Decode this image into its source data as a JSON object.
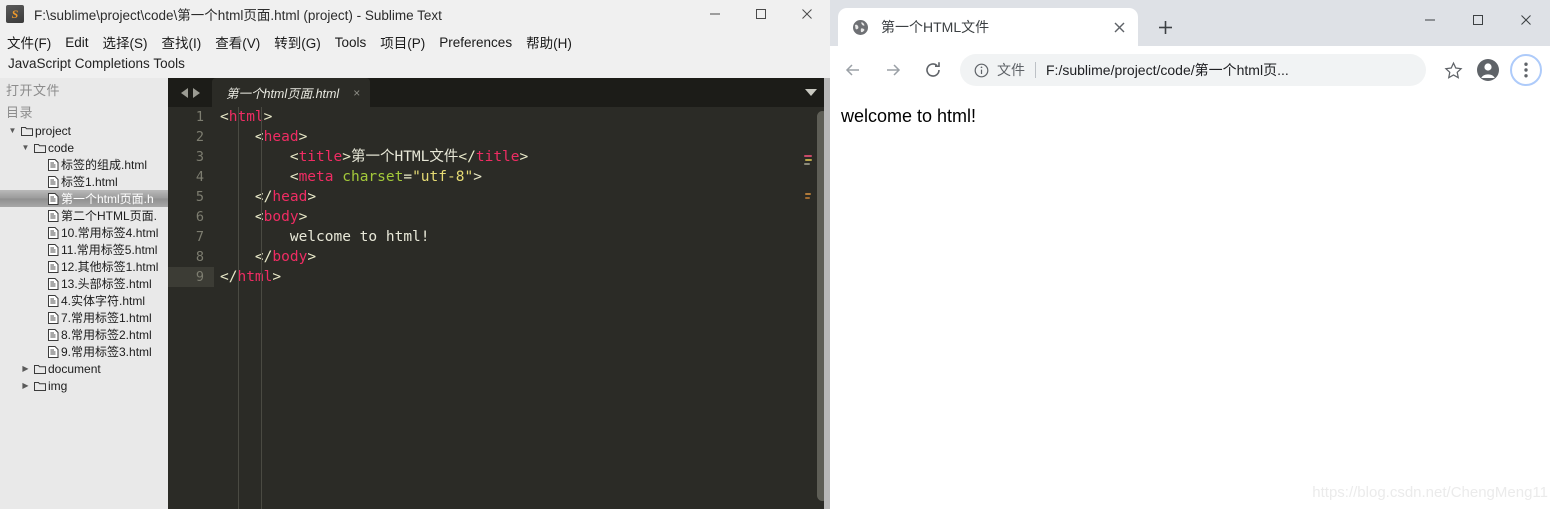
{
  "sublime": {
    "title": "F:\\sublime\\project\\code\\第一个html页面.html (project) - Sublime Text",
    "app_icon": "S",
    "window_controls": [
      {
        "name": "minimize-button",
        "glyph": "minimize"
      },
      {
        "name": "maximize-button",
        "glyph": "maximize"
      },
      {
        "name": "close-button",
        "glyph": "close"
      }
    ],
    "menu": [
      "文件(F)",
      "Edit",
      "选择(S)",
      "查找(I)",
      "查看(V)",
      "转到(G)",
      "Tools",
      "项目(P)",
      "Preferences",
      "帮助(H)"
    ],
    "status_line": "JavaScript Completions Tools",
    "sidebar": {
      "headers": [
        "打开文件",
        "目录"
      ],
      "tree": [
        {
          "label": "project",
          "type": "folder",
          "depth": 0,
          "arrow": "▼",
          "selected": false
        },
        {
          "label": "code",
          "type": "folder",
          "depth": 1,
          "arrow": "▼",
          "selected": false
        },
        {
          "label": "标签的组成.html",
          "type": "file",
          "depth": 2,
          "arrow": "",
          "selected": false
        },
        {
          "label": "标签1.html",
          "type": "file",
          "depth": 2,
          "arrow": "",
          "selected": false
        },
        {
          "label": "第一个html页面.h",
          "type": "file",
          "depth": 2,
          "arrow": "",
          "selected": true
        },
        {
          "label": "第二个HTML页面.",
          "type": "file",
          "depth": 2,
          "arrow": "",
          "selected": false
        },
        {
          "label": "10.常用标签4.html",
          "type": "file",
          "depth": 2,
          "arrow": "",
          "selected": false
        },
        {
          "label": "11.常用标签5.html",
          "type": "file",
          "depth": 2,
          "arrow": "",
          "selected": false
        },
        {
          "label": "12.其他标签1.html",
          "type": "file",
          "depth": 2,
          "arrow": "",
          "selected": false
        },
        {
          "label": "13.头部标签.html",
          "type": "file",
          "depth": 2,
          "arrow": "",
          "selected": false
        },
        {
          "label": "4.实体字符.html",
          "type": "file",
          "depth": 2,
          "arrow": "",
          "selected": false
        },
        {
          "label": "7.常用标签1.html",
          "type": "file",
          "depth": 2,
          "arrow": "",
          "selected": false
        },
        {
          "label": "8.常用标签2.html",
          "type": "file",
          "depth": 2,
          "arrow": "",
          "selected": false
        },
        {
          "label": "9.常用标签3.html",
          "type": "file",
          "depth": 2,
          "arrow": "",
          "selected": false
        },
        {
          "label": "document",
          "type": "folder",
          "depth": 1,
          "arrow": "▶",
          "selected": false
        },
        {
          "label": "img",
          "type": "folder",
          "depth": 1,
          "arrow": "▶",
          "selected": false
        }
      ]
    },
    "editor": {
      "tab_label": "第一个html页面.html",
      "tab_close": "×",
      "active_line": 9,
      "lines": [
        {
          "n": "1",
          "indent": 0,
          "segs": [
            {
              "t": "<",
              "c": "brk"
            },
            {
              "t": "html",
              "c": "tag"
            },
            {
              "t": ">",
              "c": "brk"
            }
          ]
        },
        {
          "n": "2",
          "indent": 1,
          "segs": [
            {
              "t": "<",
              "c": "brk"
            },
            {
              "t": "head",
              "c": "tag"
            },
            {
              "t": ">",
              "c": "brk"
            }
          ]
        },
        {
          "n": "3",
          "indent": 2,
          "segs": [
            {
              "t": "<",
              "c": "brk"
            },
            {
              "t": "title",
              "c": "tag"
            },
            {
              "t": ">",
              "c": "brk"
            },
            {
              "t": "第一个HTML文件",
              "c": "txt"
            },
            {
              "t": "</",
              "c": "brk"
            },
            {
              "t": "title",
              "c": "tag"
            },
            {
              "t": ">",
              "c": "brk"
            }
          ]
        },
        {
          "n": "4",
          "indent": 2,
          "segs": [
            {
              "t": "<",
              "c": "brk"
            },
            {
              "t": "meta",
              "c": "tag"
            },
            {
              "t": " ",
              "c": "txt"
            },
            {
              "t": "charset",
              "c": "attr"
            },
            {
              "t": "=",
              "c": "brk"
            },
            {
              "t": "\"utf-8\"",
              "c": "str"
            },
            {
              "t": ">",
              "c": "brk"
            }
          ]
        },
        {
          "n": "5",
          "indent": 1,
          "segs": [
            {
              "t": "</",
              "c": "brk"
            },
            {
              "t": "head",
              "c": "tag"
            },
            {
              "t": ">",
              "c": "brk"
            }
          ]
        },
        {
          "n": "6",
          "indent": 1,
          "segs": [
            {
              "t": "<",
              "c": "brk"
            },
            {
              "t": "body",
              "c": "tag"
            },
            {
              "t": ">",
              "c": "brk"
            }
          ]
        },
        {
          "n": "7",
          "indent": 2,
          "segs": [
            {
              "t": "welcome to html!",
              "c": "txt"
            }
          ]
        },
        {
          "n": "8",
          "indent": 1,
          "segs": [
            {
              "t": "</",
              "c": "brk"
            },
            {
              "t": "body",
              "c": "tag"
            },
            {
              "t": ">",
              "c": "brk"
            }
          ]
        },
        {
          "n": "9",
          "indent": 0,
          "segs": [
            {
              "t": "</",
              "c": "brk"
            },
            {
              "t": "html",
              "c": "tag"
            },
            {
              "t": ">",
              "c": "brk"
            }
          ]
        }
      ]
    }
  },
  "browser": {
    "tab": {
      "title": "第一个HTML文件",
      "close_label": "×",
      "favicon": "globe-icon"
    },
    "new_tab_label": "+",
    "window_controls": [
      {
        "name": "minimize-button",
        "glyph": "minimize"
      },
      {
        "name": "maximize-button",
        "glyph": "maximize"
      },
      {
        "name": "close-button",
        "glyph": "close"
      }
    ],
    "toolbar": {
      "back": "back-arrow-icon",
      "forward": "forward-arrow-icon",
      "reload": "reload-icon",
      "omnibox_scheme": "文件",
      "omnibox_url": "F:/sublime/project/code/第一个html页...",
      "bookmark": "star-icon",
      "profile": "profile-avatar-icon",
      "menu": "three-dot-menu-icon"
    },
    "page": {
      "body_text": "welcome to html!",
      "watermark": "https://blog.csdn.net/ChengMeng11"
    }
  },
  "colors": {
    "sublime_bg": "#2b2b26",
    "sublime_chrome": "#f0f0f0",
    "tag_pink": "#ef2c63",
    "attr_green": "#a3c93a",
    "string_yellow": "#e6db74",
    "browser_tabstrip": "#dee1e6",
    "omnibox_bg": "#f1f3f4",
    "focus_ring": "#aecbfa"
  }
}
